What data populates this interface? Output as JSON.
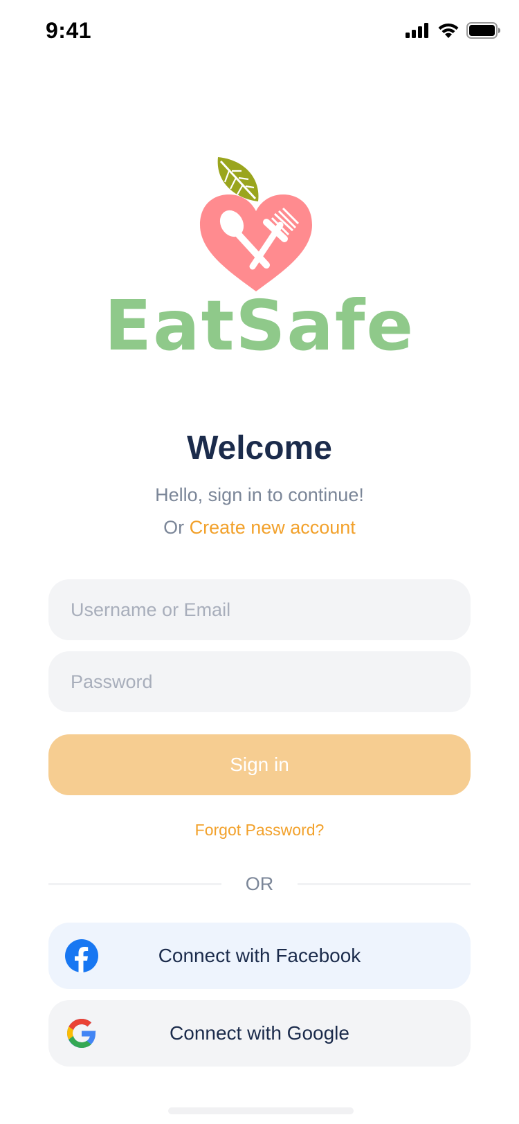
{
  "status_bar": {
    "time": "9:41"
  },
  "brand": {
    "name": "EatSafe",
    "logo_icon": "heart-utensils-leaf-icon",
    "colors": {
      "wordmark": "#8fc98a",
      "heart": "#ff8b8f",
      "leaf": "#9aa51d"
    }
  },
  "welcome": {
    "title": "Welcome",
    "subtitle": "Hello, sign in to continue!",
    "create_prefix": "Or ",
    "create_link": "Create new account"
  },
  "form": {
    "username_placeholder": "Username or Email",
    "username_value": "",
    "password_placeholder": "Password",
    "password_value": "",
    "signin_label": "Sign in",
    "forgot_label": "Forgot Password?"
  },
  "divider": {
    "label": "OR"
  },
  "social": {
    "facebook_label": "Connect with Facebook",
    "google_label": "Connect with Google"
  },
  "theme": {
    "accent": "#f2a12b",
    "signin_bg": "#f6cd91",
    "field_bg": "#f3f4f6",
    "facebook_bg": "#eef4fd",
    "title": "#1b2b4b",
    "muted": "#7b8698"
  }
}
